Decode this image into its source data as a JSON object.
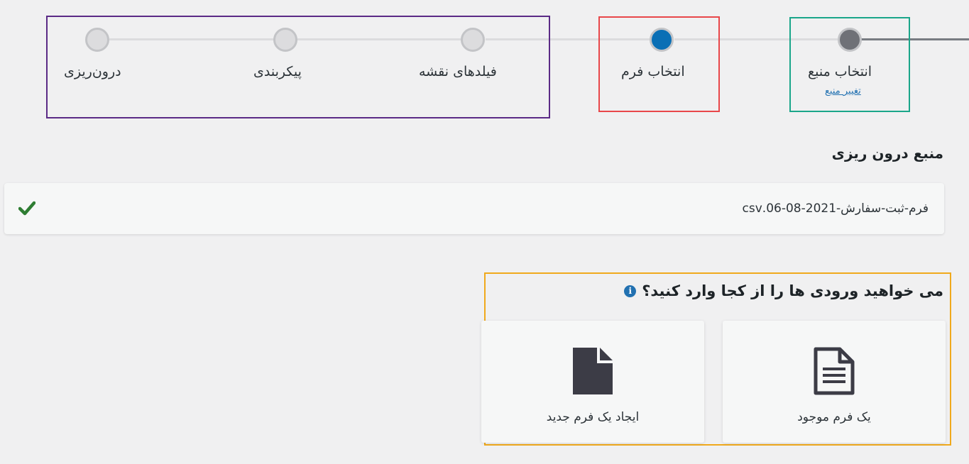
{
  "stepper": {
    "steps": [
      {
        "label": "انتخاب منبع",
        "sublink": "تغییر منبع",
        "state": "done"
      },
      {
        "label": "انتخاب فرم",
        "state": "active"
      },
      {
        "label": "فیلدهای نقشه",
        "state": "pending"
      },
      {
        "label": "پیکربندی",
        "state": "pending"
      },
      {
        "label": "درون‌ریزی",
        "state": "pending"
      }
    ]
  },
  "source": {
    "title": "منبع درون ریزی",
    "filename": "فرم-ثبت-سفارش-2021-08-06.csv",
    "status_icon": "check-icon"
  },
  "question": {
    "text": "می خواهید ورودی ها را از کجا وارد کنید؟",
    "info_icon": "info-icon"
  },
  "choices": [
    {
      "label": "یک فرم موجود",
      "icon": "document-text-icon"
    },
    {
      "label": "ایجاد یک فرم جدید",
      "icon": "document-blank-icon"
    }
  ],
  "colors": {
    "accent": "#0a6fb5",
    "done": "#6f7177",
    "success": "#2e7d32",
    "highlight_green": "#1aa68a",
    "highlight_red": "#e8474a",
    "highlight_purple": "#5b2a86",
    "highlight_orange": "#f0a91c"
  }
}
